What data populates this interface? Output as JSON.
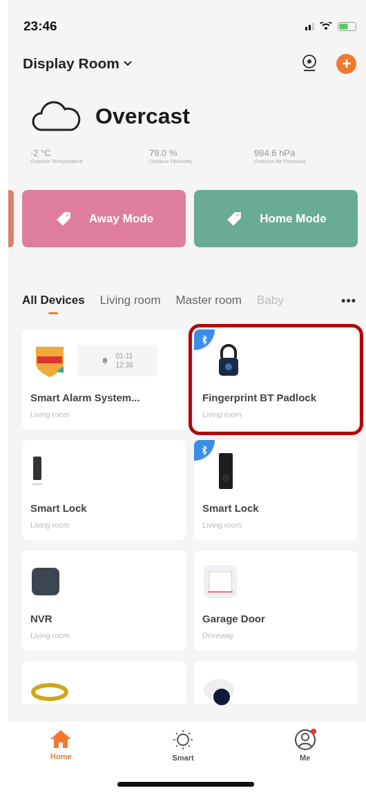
{
  "status_bar": {
    "time": "23:46"
  },
  "header": {
    "room": "Display Room"
  },
  "weather": {
    "condition": "Overcast",
    "stats": [
      {
        "value": "-2 °C",
        "label": "Outdoor Temperature"
      },
      {
        "value": "79.0 %",
        "label": "Outdoor Humidity"
      },
      {
        "value": "984.6 hPa",
        "label": "Outdoor Air Pressure"
      }
    ]
  },
  "modes": [
    {
      "label": "Away Mode",
      "color": "#de7e9c"
    },
    {
      "label": "Home Mode",
      "color": "#6aab96"
    }
  ],
  "tabs": [
    {
      "label": "All Devices",
      "selected": true
    },
    {
      "label": "Living room",
      "selected": false
    },
    {
      "label": "Master room",
      "selected": false
    },
    {
      "label": "Baby",
      "selected": false
    }
  ],
  "more": "•••",
  "devices": [
    {
      "name": "Smart Alarm System...",
      "room": "Living room",
      "bluetooth": false,
      "highlighted": false,
      "event": {
        "date": "01-11",
        "time": "12:39"
      }
    },
    {
      "name": "Fingerprint BT Padlock",
      "room": "Living room",
      "bluetooth": true,
      "highlighted": true
    },
    {
      "name": "Smart Lock",
      "room": "Living room",
      "bluetooth": false,
      "highlighted": false
    },
    {
      "name": "Smart Lock",
      "room": "Living room",
      "bluetooth": true,
      "highlighted": false
    },
    {
      "name": "NVR",
      "room": "Living room",
      "bluetooth": false,
      "highlighted": false
    },
    {
      "name": "Garage Door",
      "room": "Driveway",
      "bluetooth": false,
      "highlighted": false
    },
    {
      "bluetooth": false,
      "highlighted": false
    },
    {
      "bluetooth": false,
      "highlighted": false
    }
  ],
  "nav": [
    {
      "label": "Home",
      "selected": true,
      "badge": false
    },
    {
      "label": "Smart",
      "selected": false,
      "badge": false
    },
    {
      "label": "Me",
      "selected": false,
      "badge": true
    }
  ]
}
